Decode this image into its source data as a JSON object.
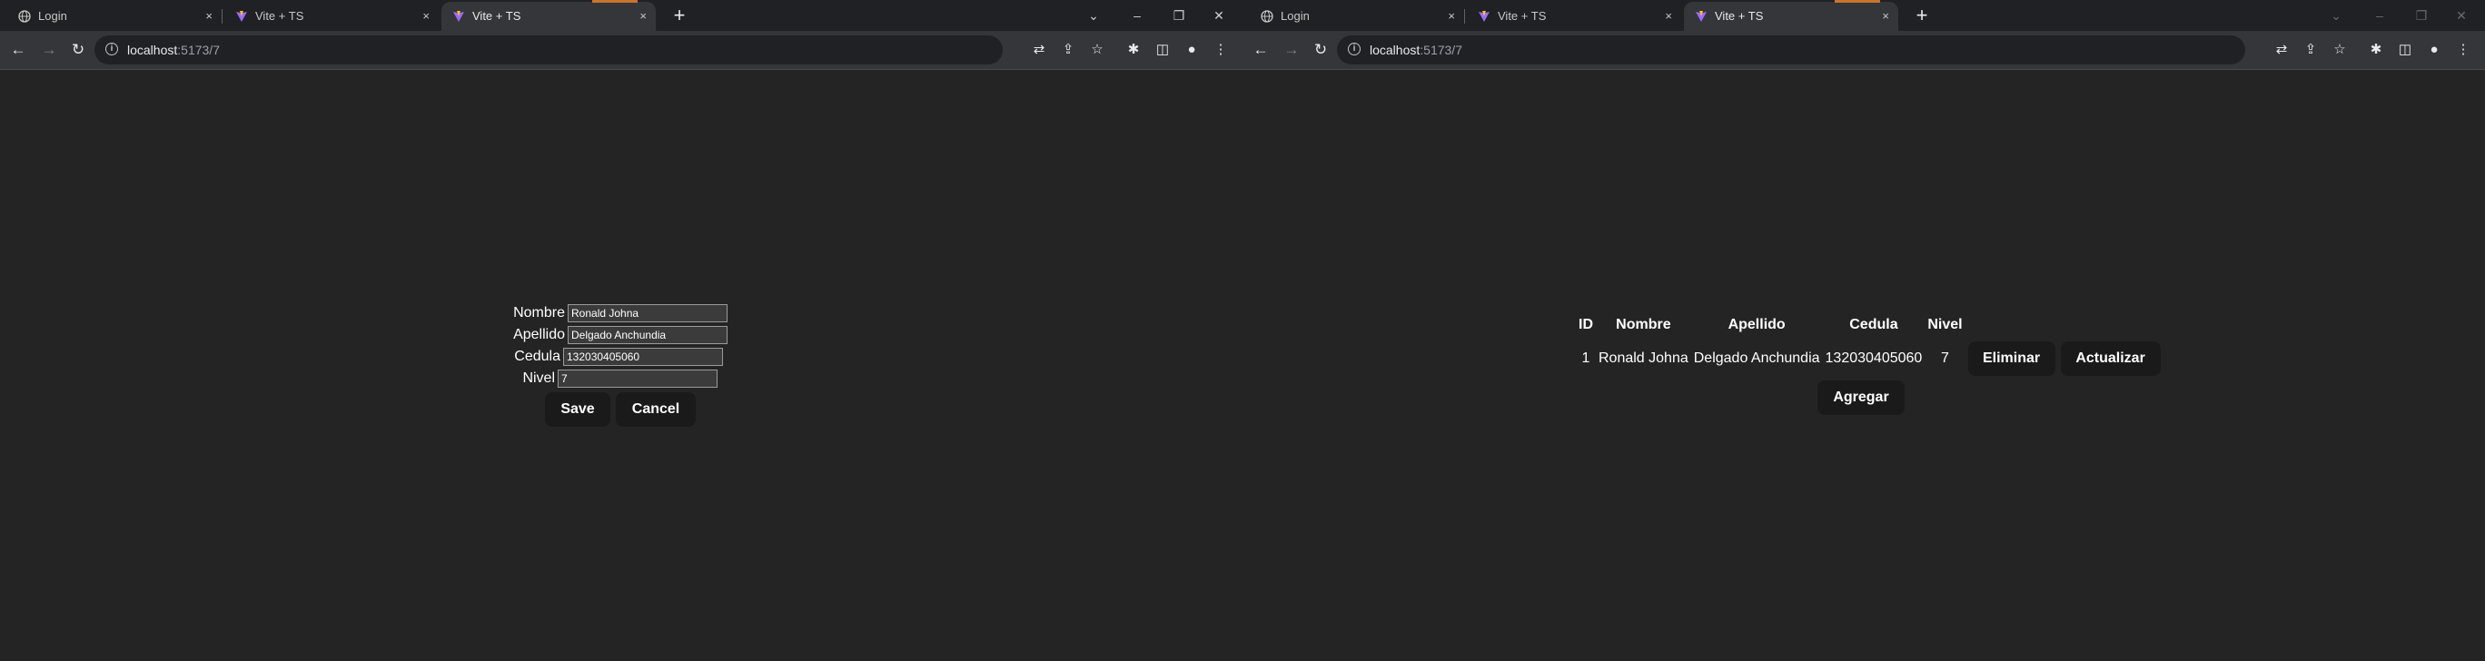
{
  "browser": {
    "tabs": [
      {
        "title": "Login",
        "close": "×"
      },
      {
        "title": "Vite + TS",
        "close": "×"
      },
      {
        "title": "Vite + TS",
        "close": "×"
      }
    ],
    "new_tab": "+",
    "url_host": "localhost",
    "url_rest": ":5173/7",
    "window_controls": {
      "tab_search": "⌄",
      "minimize": "–",
      "restore": "❐",
      "close": "✕"
    },
    "nav": {
      "back": "←",
      "forward": "→",
      "reload": "↻"
    },
    "toolbar_icons": {
      "translate": "⇄",
      "share": "⇪",
      "star": "☆",
      "extensions": "✱",
      "side_panel": "◫",
      "profile": "●",
      "menu": "⋮"
    }
  },
  "form": {
    "nombre_label": "Nombre",
    "nombre_value": "Ronald Johna",
    "apellido_label": "Apellido",
    "apellido_value": "Delgado Anchundia",
    "cedula_label": "Cedula",
    "cedula_value": "132030405060",
    "nivel_label": "Nivel",
    "nivel_value": "7",
    "save_label": "Save",
    "cancel_label": "Cancel"
  },
  "table": {
    "headers": {
      "id": "ID",
      "nombre": "Nombre",
      "apellido": "Apellido",
      "cedula": "Cedula",
      "nivel": "Nivel"
    },
    "rows": [
      {
        "id": "1",
        "nombre": "Ronald Johna",
        "apellido": "Delgado Anchundia",
        "cedula": "132030405060",
        "nivel": "7",
        "delete_label": "Eliminar",
        "update_label": "Actualizar"
      }
    ],
    "add_label": "Agregar"
  }
}
